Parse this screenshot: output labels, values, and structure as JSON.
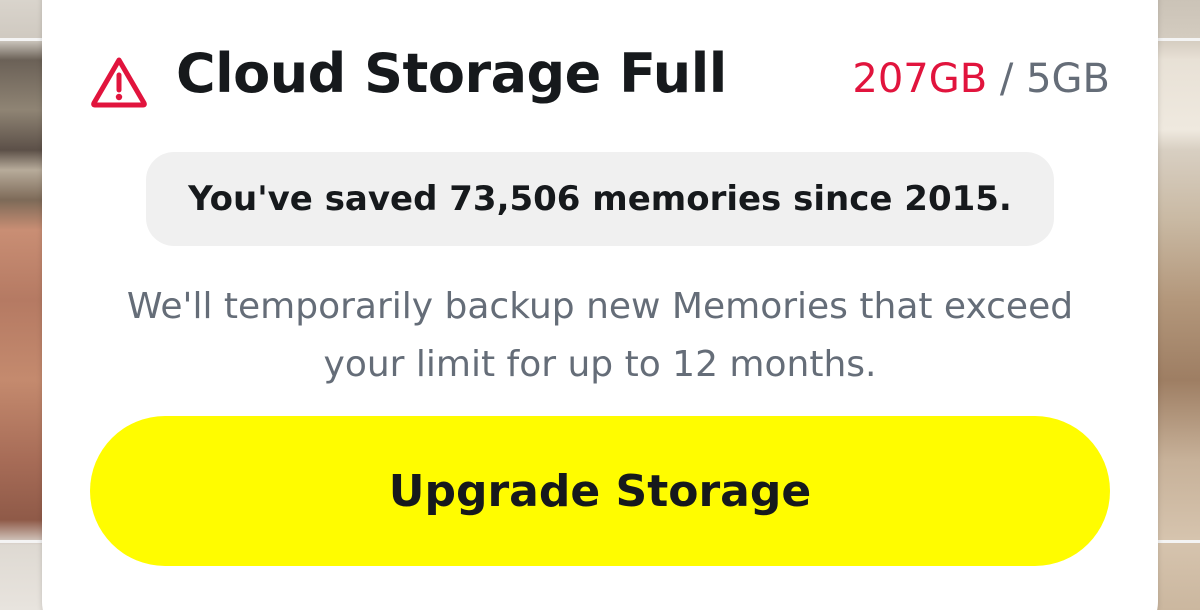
{
  "dialog": {
    "title": "Cloud Storage Full",
    "usage": {
      "used": "207GB",
      "separator": " / ",
      "limit": "5GB"
    },
    "memories_summary": "You've saved 73,506 memories since 2015.",
    "description_line1": "We'll temporarily backup new Memories that exceed",
    "description_line2": "your limit for up to 12 months.",
    "upgrade_button_label": "Upgrade Storage",
    "icon": "warning-triangle-icon"
  },
  "colors": {
    "accent_yellow": "#fffc00",
    "warning_red": "#e1143d",
    "text_dark": "#16191c",
    "text_muted": "#656d78",
    "pill_background": "#f0f0f0"
  }
}
